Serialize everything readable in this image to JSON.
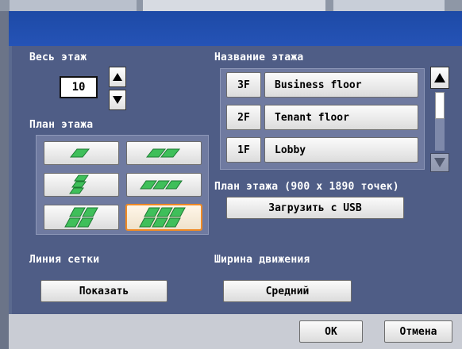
{
  "left": {
    "whole_floor_label": "Весь этаж",
    "floor_count": "10",
    "floor_plan_label": "План этажа",
    "grid_line_label": "Линия сетки",
    "show_button": "Показать"
  },
  "right": {
    "floor_name_label": "Название этажа",
    "floors": [
      {
        "code": "3F",
        "name": "Business floor"
      },
      {
        "code": "2F",
        "name": "Tenant floor"
      },
      {
        "code": "1F",
        "name": "Lobby"
      }
    ],
    "plan_info_label": "План этажа (900 x 1890 точек)",
    "load_usb_button": "Загрузить с USB",
    "move_width_label": "Ширина движения",
    "medium_button": "Средний"
  },
  "footer": {
    "ok_button": "OK",
    "cancel_button": "Отмена"
  },
  "layout_options": [
    1,
    2,
    3,
    3,
    6,
    9
  ],
  "selected_layout_index": 5,
  "colors": {
    "title_bar": "#2553b6",
    "dialog_bg": "#4f5d86",
    "tile_green": "#3fbf5a",
    "selection": "#f08a24"
  }
}
